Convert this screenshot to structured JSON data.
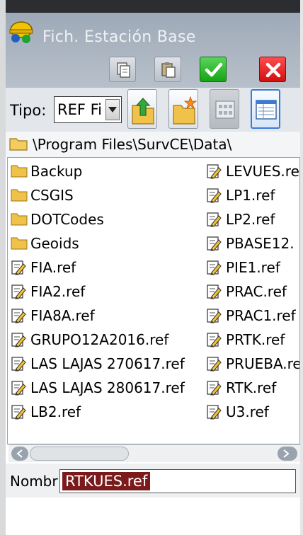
{
  "window": {
    "title": "Fich. Estación Base"
  },
  "toolbar": {
    "buttons": [
      {
        "name": "copy-icon"
      },
      {
        "name": "paste-icon"
      },
      {
        "name": "ok-checkmark-icon"
      },
      {
        "name": "cancel-x-icon"
      }
    ],
    "colors": {
      "ok": "#1eae1e",
      "cancel": "#e41414"
    }
  },
  "filter": {
    "label": "Tipo:",
    "selected": "REF Fi"
  },
  "tools": [
    {
      "name": "up-folder-icon"
    },
    {
      "name": "new-folder-icon"
    },
    {
      "name": "icon-view-icon"
    },
    {
      "name": "list-view-icon"
    }
  ],
  "path": {
    "text": "\\Program Files\\SurvCE\\Data\\"
  },
  "files": {
    "column_a": [
      {
        "label": "Backup",
        "icon": "folder-icon"
      },
      {
        "label": "CSGIS",
        "icon": "folder-icon"
      },
      {
        "label": "DOTCodes",
        "icon": "folder-icon"
      },
      {
        "label": "Geoids",
        "icon": "folder-icon"
      },
      {
        "label": "FIA.ref",
        "icon": "ref-file-icon"
      },
      {
        "label": "FIA2.ref",
        "icon": "ref-file-icon"
      },
      {
        "label": "FIA8A.ref",
        "icon": "ref-file-icon"
      },
      {
        "label": "GRUPO12A2016.ref",
        "icon": "ref-file-icon"
      },
      {
        "label": "LAS LAJAS 270617.ref",
        "icon": "ref-file-icon"
      },
      {
        "label": "LAS LAJAS 280617.ref",
        "icon": "ref-file-icon"
      },
      {
        "label": "LB2.ref",
        "icon": "ref-file-icon"
      }
    ],
    "column_b": [
      {
        "label": "LEVUES.re",
        "icon": "ref-file-icon"
      },
      {
        "label": "LP1.ref",
        "icon": "ref-file-icon"
      },
      {
        "label": "LP2.ref",
        "icon": "ref-file-icon"
      },
      {
        "label": "PBASE12.",
        "icon": "ref-file-icon"
      },
      {
        "label": "PIE1.ref",
        "icon": "ref-file-icon"
      },
      {
        "label": "PRAC.ref",
        "icon": "ref-file-icon"
      },
      {
        "label": "PRAC1.ref",
        "icon": "ref-file-icon"
      },
      {
        "label": "PRTK.ref",
        "icon": "ref-file-icon"
      },
      {
        "label": "PRUEBA.re",
        "icon": "ref-file-icon"
      },
      {
        "label": "RTK.ref",
        "icon": "ref-file-icon"
      },
      {
        "label": "U3.ref",
        "icon": "ref-file-icon"
      }
    ]
  },
  "filename": {
    "label": "Nombr",
    "value": "RTKUES.ref",
    "selection_color": "#7b1a1a"
  }
}
